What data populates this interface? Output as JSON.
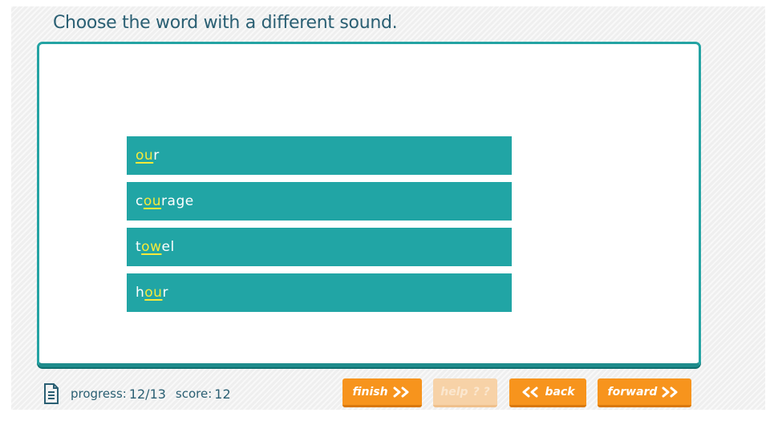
{
  "instruction": "Choose the word with a different sound.",
  "answers": [
    {
      "word": "our",
      "parts": {
        "pre": "",
        "hl": "ou",
        "post": "r"
      }
    },
    {
      "word": "courage",
      "parts": {
        "pre": "c",
        "hl": "ou",
        "post": "rage"
      }
    },
    {
      "word": "towel",
      "parts": {
        "pre": "t",
        "hl": "ow",
        "post": "el"
      }
    },
    {
      "word": "hour",
      "parts": {
        "pre": "h",
        "hl": "ou",
        "post": "r"
      }
    }
  ],
  "footer": {
    "progress_label": "progress:",
    "progress_value": "12/13",
    "score_label": "score:",
    "score_value": "12"
  },
  "buttons": {
    "finish": "finish",
    "help": "help",
    "help_marks": "? ?",
    "back": "back",
    "forward": "forward"
  },
  "colors": {
    "accent": "#21a5a5",
    "highlight": "#f6ea3a",
    "button": "#f7941d",
    "text": "#2a5f73"
  },
  "icons": {
    "progress": "document-icon",
    "finish": "double-chevron-right-icon",
    "back": "double-chevron-left-icon",
    "forward": "double-chevron-right-icon"
  }
}
